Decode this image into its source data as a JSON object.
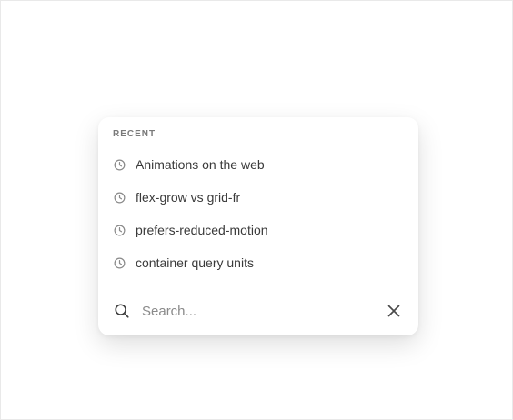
{
  "recent": {
    "heading": "RECENT",
    "items": [
      {
        "label": "Animations on the web",
        "icon": "clock-icon"
      },
      {
        "label": "flex-grow vs grid-fr",
        "icon": "clock-icon"
      },
      {
        "label": "prefers-reduced-motion",
        "icon": "clock-icon"
      },
      {
        "label": "container query units",
        "icon": "clock-icon"
      }
    ]
  },
  "search": {
    "placeholder": "Search...",
    "value": "",
    "icon": "search-icon",
    "clear_icon": "close-icon"
  },
  "colors": {
    "heading": "#7a7a7a",
    "item_text": "#3a3a3a",
    "icon": "#8a8a8a",
    "search_icon": "#3d3d3d"
  }
}
